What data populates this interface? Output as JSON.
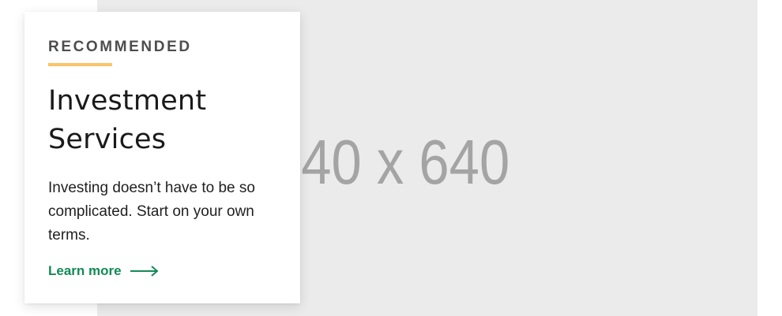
{
  "image": {
    "placeholder_label": "640 x 640"
  },
  "card": {
    "eyebrow": "RECOMMENDED",
    "title_line1": "Investment",
    "title_line2": "Services",
    "body": "Investing doesn’t have to be so complicated. Start on your own terms.",
    "link_label": "Learn more",
    "link_icon": "arrow-right-icon"
  },
  "colors": {
    "accent": "#fcc36a",
    "link": "#138a57",
    "placeholder_bg": "#ebebeb",
    "placeholder_text": "#a4a4a4"
  }
}
